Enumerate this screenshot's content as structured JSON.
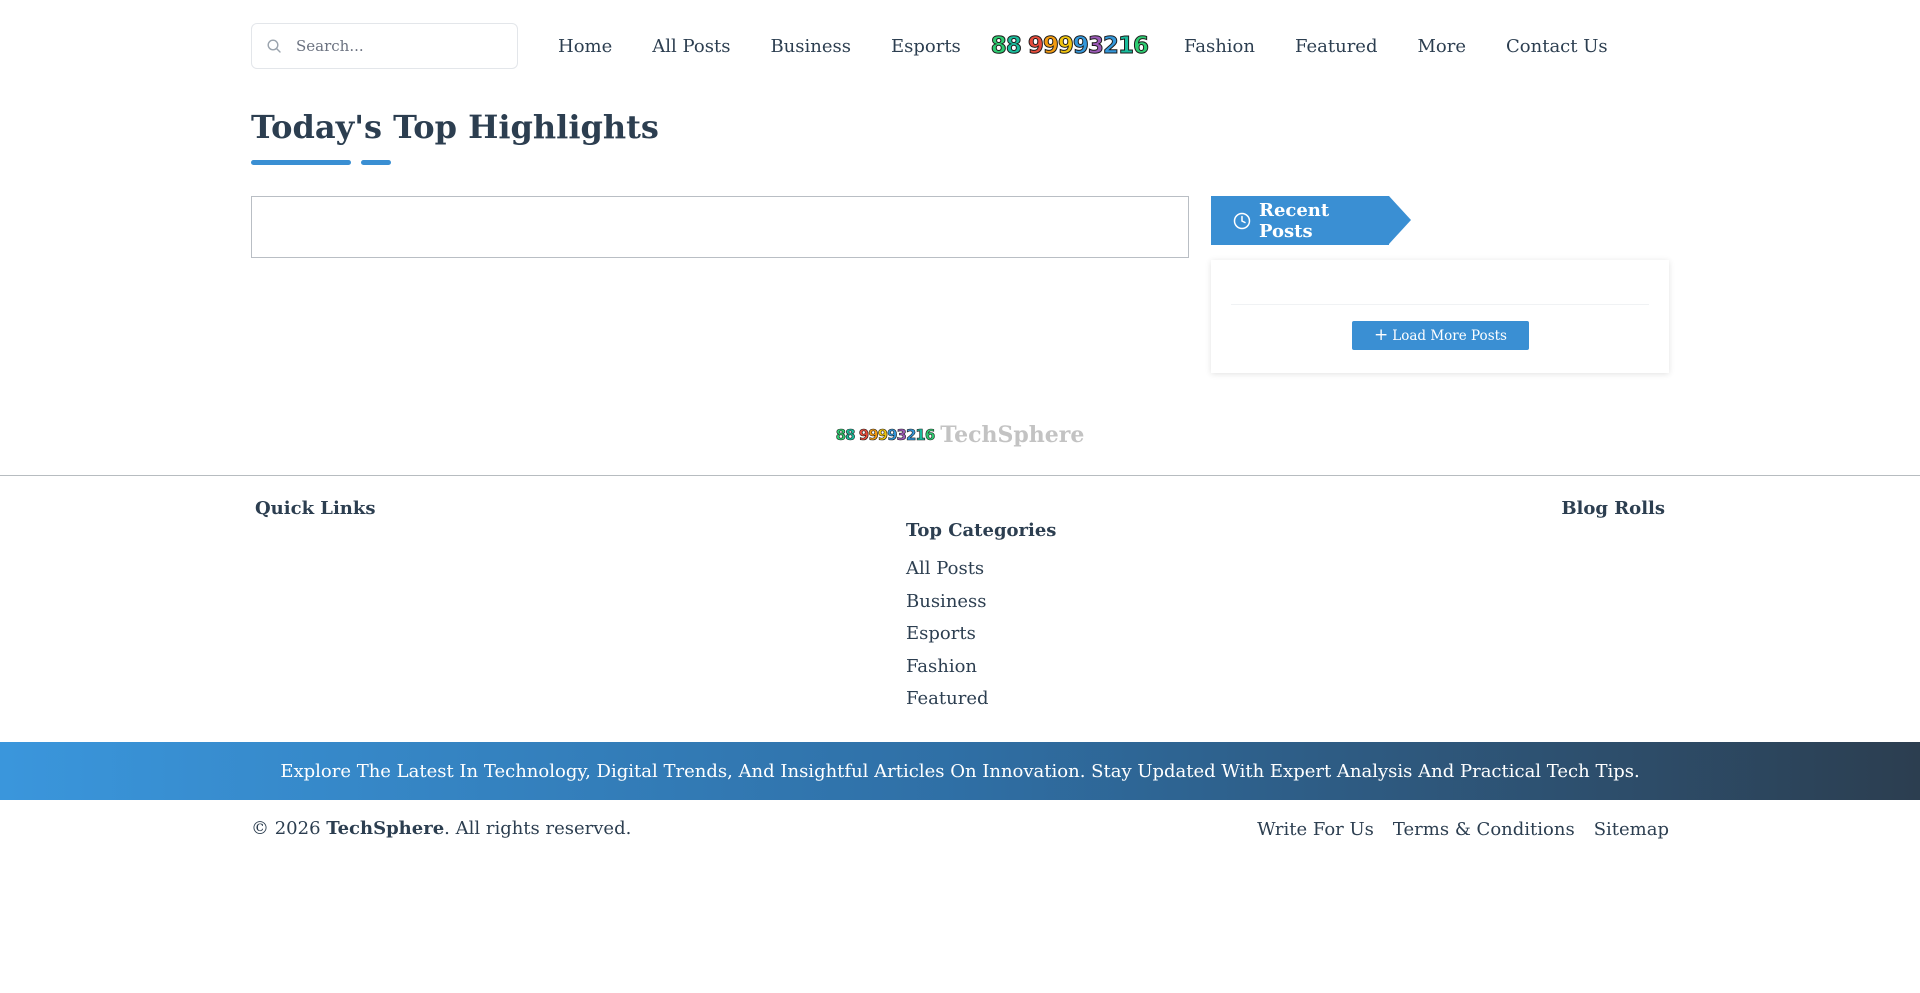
{
  "search": {
    "placeholder": "Search..."
  },
  "nav": {
    "items": [
      "Home",
      "All Posts",
      "Business",
      "Esports",
      "Fashion",
      "Featured",
      "More",
      "Contact Us"
    ],
    "logo_text": "88 99993216"
  },
  "highlights": {
    "title": "Today's Top Highlights"
  },
  "recent_posts": {
    "title": "Recent Posts",
    "load_more_label": "Load More Posts"
  },
  "footer": {
    "brand_logo": "88 99993216",
    "brand_name": "TechSphere",
    "quick_links_title": "Quick Links",
    "top_categories_title": "Top Categories",
    "categories": [
      "All Posts",
      "Business",
      "Esports",
      "Fashion",
      "Featured"
    ],
    "blog_rolls_title": "Blog Rolls"
  },
  "banner": {
    "text": "Explore The Latest In Technology, Digital Trends, And Insightful Articles On Innovation. Stay Updated With Expert Analysis And Practical Tech Tips."
  },
  "bottom": {
    "copyright_prefix": "© 2026",
    "copyright_brand": "TechSphere",
    "copyright_suffix": ". All rights reserved.",
    "links": [
      "Write For Us",
      "Terms & Conditions",
      "Sitemap"
    ]
  },
  "colors": {
    "accent": "#3a8fd3",
    "text": "#2c3e50",
    "banner_start": "#3a96dc",
    "banner_end": "#2c3e50"
  },
  "icons": {
    "search": "search-icon",
    "recent": "clock-icon",
    "load_more": "plus-icon"
  }
}
